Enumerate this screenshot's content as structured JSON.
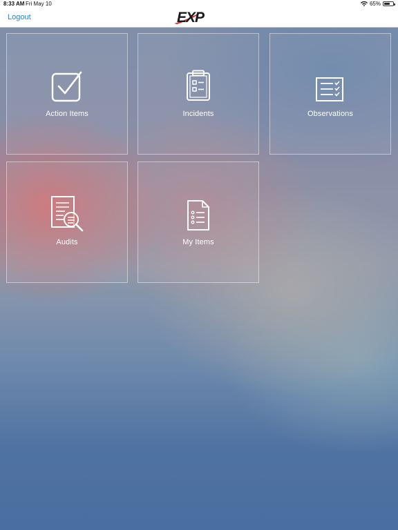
{
  "status_bar": {
    "time": "8:33 AM",
    "date": "Fri May 10",
    "battery_text": "65%",
    "battery_level": 0.65,
    "icons": [
      "wifi-icon",
      "battery-icon"
    ]
  },
  "nav": {
    "logout_label": "Logout",
    "logo_text": "EXP",
    "colors": {
      "logo_red": "#d42a2a",
      "logo_black": "#1a1a1a",
      "link": "#2d7fd2"
    }
  },
  "tiles": [
    {
      "label": "Action Items",
      "icon": "checkbox-icon"
    },
    {
      "label": "Incidents",
      "icon": "clipboard-icon"
    },
    {
      "label": "Observations",
      "icon": "checklist-icon"
    },
    {
      "label": "Audits",
      "icon": "document-search-icon"
    },
    {
      "label": "My Items",
      "icon": "document-list-icon"
    }
  ]
}
